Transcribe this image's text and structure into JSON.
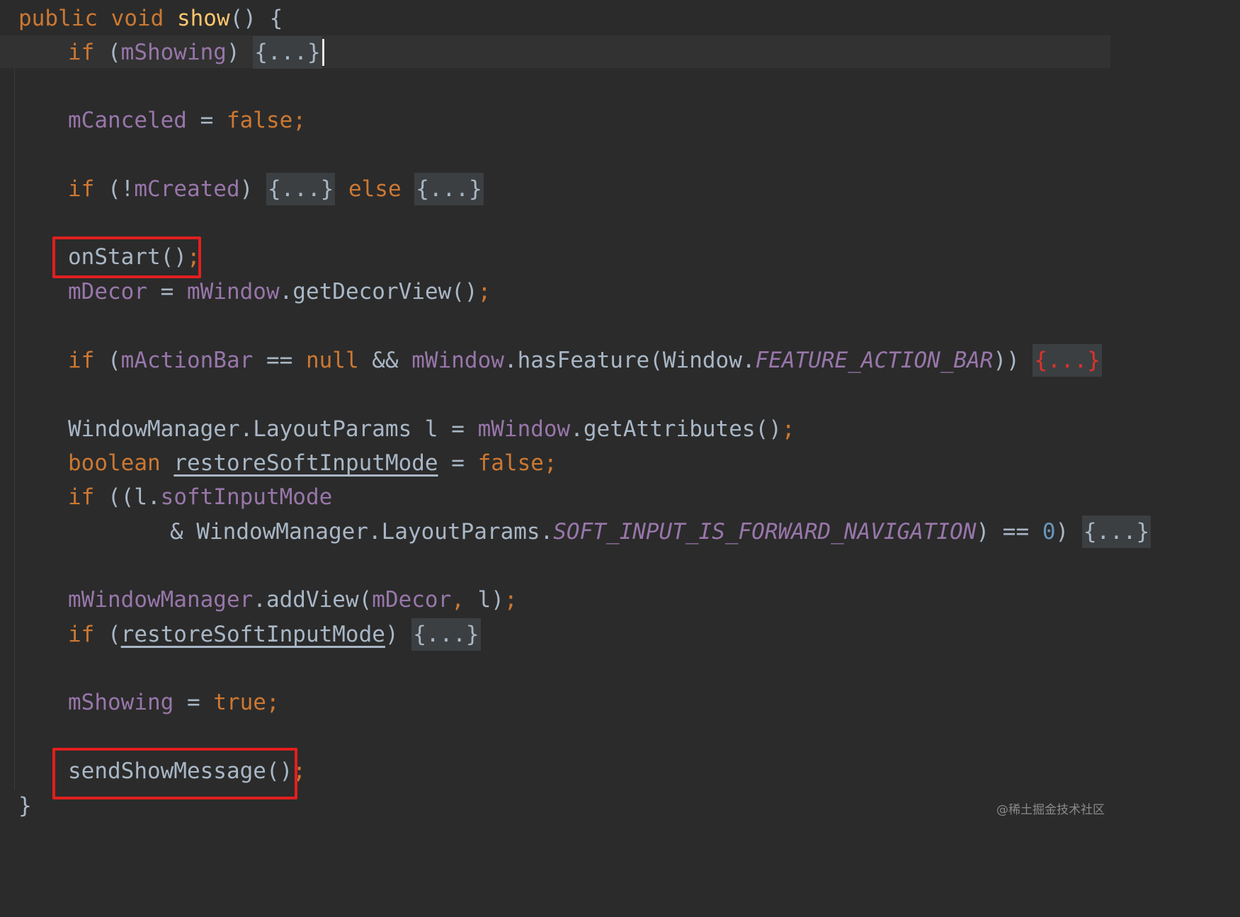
{
  "editor": {
    "language": "java",
    "colors": {
      "background": "#2b2b2b",
      "keyword": "#cc7832",
      "method_decl": "#ffc66d",
      "field": "#9876aa",
      "default": "#a9b7c6",
      "number": "#6897bb",
      "fold_bg": "#3c3f41",
      "highlight_box": "#e21f1f"
    },
    "code": {
      "l1_kw1": "public",
      "l1_kw2": "void",
      "l1_fn": "show",
      "l1_rest": "() {",
      "l2_kw": "if",
      "l2_open": " (",
      "l2_field": "mShowing",
      "l2_close": ") ",
      "fold": "{...}",
      "l3_field": "mCanceled",
      "l3_eq": " = ",
      "l3_val": "false",
      "semi": ";",
      "l4_kw": "if",
      "l4_open": " (!",
      "l4_field": "mCreated",
      "l4_close": ") ",
      "l4_else": "else",
      "l5_call": "onStart()",
      "l6_field": "mDecor",
      "l6_eq": " = ",
      "l6_obj": "mWindow",
      "l6_call": ".getDecorView()",
      "l7_kw": "if",
      "l7_open": " (",
      "l7_field": "mActionBar",
      "l7_op": " == ",
      "l7_null": "null",
      "l7_and": " && ",
      "l7_obj": "mWindow",
      "l7_call": ".hasFeature(Window.",
      "l7_const": "FEATURE_ACTION_BAR",
      "l7_close": ")) ",
      "l8_type": "WindowManager.LayoutParams l = ",
      "l8_obj": "mWindow",
      "l8_call": ".getAttributes()",
      "l9_kw": "boolean",
      "l9_var": "restoreSoftInputMode",
      "l9_eq": " = ",
      "l9_val": "false",
      "l10_kw": "if",
      "l10_open": " ((l.",
      "l10_field": "softInputMode",
      "l11_amp": "& WindowManager.LayoutParams.",
      "l11_const": "SOFT_INPUT_IS_FORWARD_NAVIGATION",
      "l11_op": ") == ",
      "l11_num": "0",
      "l11_close": ") ",
      "l12_field": "mWindowManager",
      "l12_call": ".addView(",
      "l12_arg": "mDecor",
      "l12_comma": ",",
      "l12_rest": " l)",
      "l13_kw": "if",
      "l13_open": " (",
      "l13_var": "restoreSoftInputMode",
      "l13_close": ") ",
      "l14_field": "mShowing",
      "l14_eq": " = ",
      "l14_val": "true",
      "l15_call": "sendShowMessage()",
      "l16": "}"
    }
  },
  "watermark": "@稀土掘金技术社区"
}
